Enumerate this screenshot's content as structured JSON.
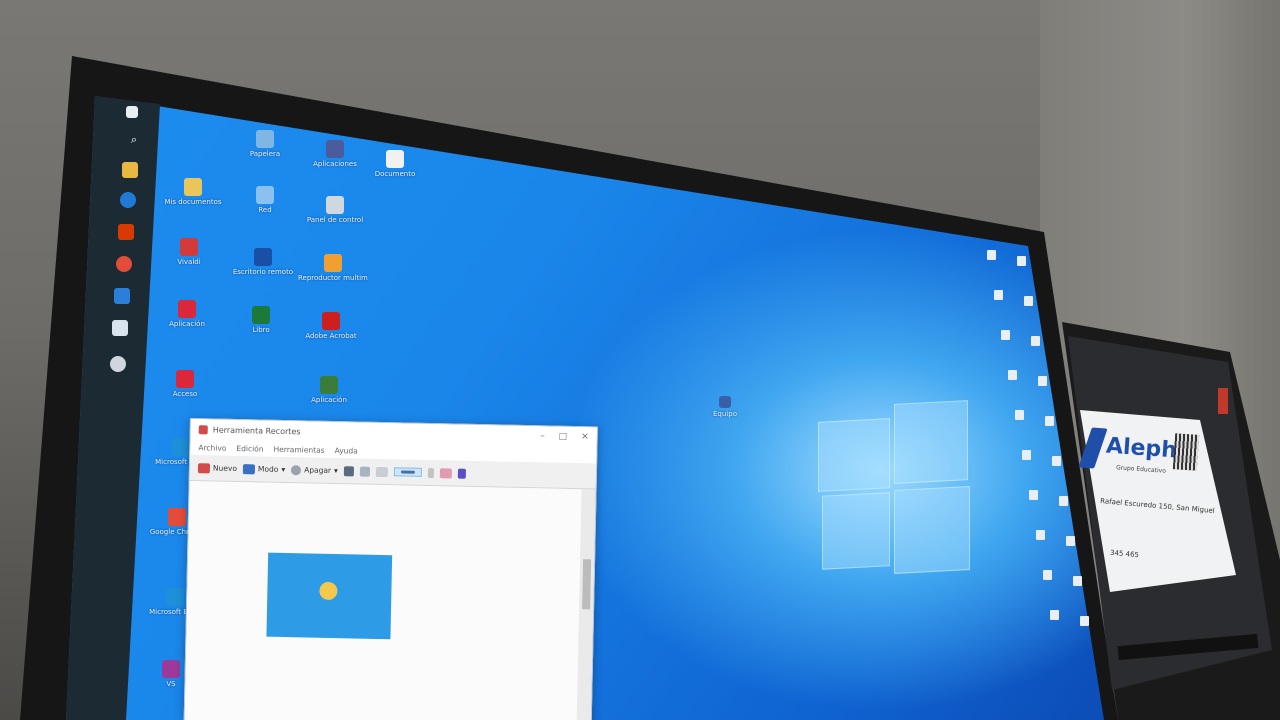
{
  "taskbar": {
    "icons": [
      "windows-start-icon",
      "search-icon",
      "file-explorer-icon",
      "firefox-icon",
      "office-icon",
      "chrome-icon",
      "vscode-icon",
      "app-icon",
      "disk-icon"
    ]
  },
  "desktop": {
    "left_icons": [
      {
        "name": "recycle-bin",
        "label": "Papelera",
        "color": "#7fb6e3"
      },
      {
        "name": "folder-app",
        "label": "Aplicaciones",
        "color": "#4a5d9a"
      },
      {
        "name": "document",
        "label": "Documento",
        "color": "#f1f1f1"
      },
      {
        "name": "shortcut-1",
        "label": "Mis documentos",
        "color": "#e9c55b"
      },
      {
        "name": "network",
        "label": "Red",
        "color": "#8bc0ef"
      },
      {
        "name": "control-panel",
        "label": "Panel de control",
        "color": "#cfd7e1"
      },
      {
        "name": "vivaldi",
        "label": "Vivaldi",
        "color": "#d33a3a"
      },
      {
        "name": "remote-desktop",
        "label": "Escritorio remoto",
        "color": "#1a4fa8"
      },
      {
        "name": "vlc",
        "label": "Reproductor multimedia",
        "color": "#f0a030"
      },
      {
        "name": "app-red",
        "label": "Aplicación",
        "color": "#d8283a"
      },
      {
        "name": "excel",
        "label": "Libro",
        "color": "#1b7a3a"
      },
      {
        "name": "acrobat",
        "label": "Adobe Acrobat",
        "color": "#cc1f1f"
      },
      {
        "name": "app-red-2",
        "label": "Acceso",
        "color": "#d8283a"
      },
      {
        "name": "google-app",
        "label": "Aplicación",
        "color": "#3a7d3a"
      },
      {
        "name": "edge",
        "label": "Microsoft Edge",
        "color": "#1e8fd8"
      },
      {
        "name": "chrome",
        "label": "Google Chrome",
        "color": "#e44c3a"
      },
      {
        "name": "edge-2",
        "label": "Microsoft Edge",
        "color": "#1e8fd8"
      },
      {
        "name": "vs-app",
        "label": "VS",
        "color": "#9b3a9b"
      }
    ],
    "center_icon": {
      "label": "Equipo",
      "color": "#3a5fa8"
    },
    "right_icon_count": 20
  },
  "snipping_tool": {
    "title": "Herramienta Recortes",
    "menu": [
      "Archivo",
      "Edición",
      "Herramientas",
      "Ayuda"
    ],
    "tools": {
      "new": "Nuevo",
      "mode": "Modo",
      "delay": "Apagar"
    }
  },
  "second_monitor": {
    "brand": "Aleph",
    "tagline": "Grupo Educativo",
    "address": "Rafael Escuredo 150, San Miguel",
    "phone": "345 465"
  }
}
